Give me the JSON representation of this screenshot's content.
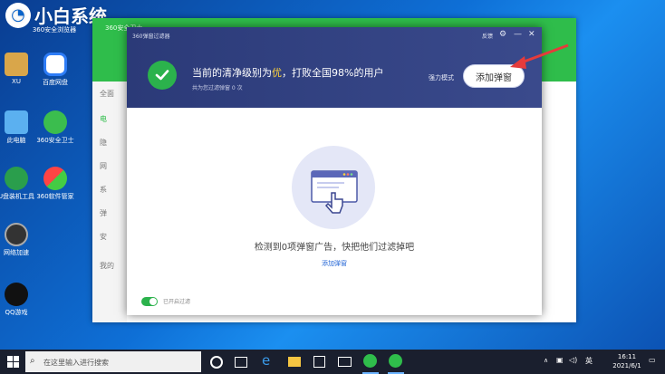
{
  "watermark": {
    "text": "小白系统"
  },
  "desktop_icons": [
    {
      "label": "360安全浏览器"
    },
    {
      "label": "XU"
    },
    {
      "label": "百度网盘"
    },
    {
      "label": "此电脑"
    },
    {
      "label": "360安全卫士"
    },
    {
      "label": "U盘装机工具"
    },
    {
      "label": "360软件管家"
    },
    {
      "label": "网络加速"
    },
    {
      "label": "QQ游戏"
    }
  ],
  "dialog": {
    "title": "360弹窗过滤器",
    "feedback": "反馈",
    "headline_prefix": "当前的清净级别为",
    "headline_level": "优",
    "headline_suffix": "，打败全国98%的用户",
    "subline": "共为您过滤弹窗 0 次",
    "mode_label": "强力模式",
    "add_button": "添加弹窗",
    "empty_text": "检测到0项弹窗广告，快把他们过滤掉吧",
    "empty_link": "添加弹窗",
    "toggle_label": "已开启过滤"
  },
  "main_window": {
    "title": "360安全卫士",
    "sidebar": [
      "全面",
      "电",
      "隐",
      "网",
      "系",
      "弹",
      "安",
      "我的"
    ]
  },
  "taskbar": {
    "search_placeholder": "在这里输入进行搜索",
    "lang": "英",
    "time": "16:11",
    "date": "2021/6/1"
  }
}
